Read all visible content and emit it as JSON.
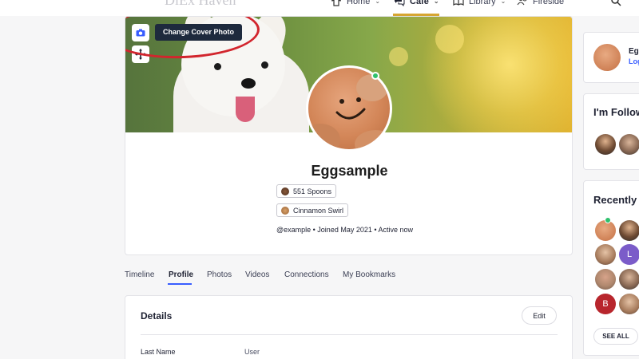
{
  "nav": {
    "logo": "DiEx Haven",
    "items": [
      {
        "label": "Home",
        "icon": "shirt-icon"
      },
      {
        "label": "Cafe",
        "icon": "chat-icon"
      },
      {
        "label": "Library",
        "icon": "book-icon"
      },
      {
        "label": "Fireside",
        "icon": "people-icon"
      }
    ],
    "active": "Cafe",
    "accent_color": "#d6a531"
  },
  "cover": {
    "tooltip": "Change Cover Photo",
    "camera_icon": "camera-icon",
    "move_icon": "move-icon",
    "annotation_color": "#d2252d"
  },
  "profile": {
    "name": "Eggsample",
    "badges": [
      "551 Spoons",
      "Cinnamon Swirl"
    ],
    "meta": "@example • Joined May 2021 • Active now",
    "online_color": "#2fc16d"
  },
  "tabs": [
    "Timeline",
    "Profile",
    "Photos",
    "Videos",
    "Connections",
    "My Bookmarks"
  ],
  "active_tab": "Profile",
  "details": {
    "title": "Details",
    "edit_label": "Edit",
    "fields": [
      {
        "label": "Last Name",
        "value": "User"
      }
    ]
  },
  "sidebar": {
    "user_card": {
      "name": "Egg",
      "link": "Log"
    },
    "following_title": "I'm Follow",
    "recent_title": "Recently A",
    "recent_letters": [
      "L",
      "B"
    ],
    "see_all": "SEE ALL"
  }
}
